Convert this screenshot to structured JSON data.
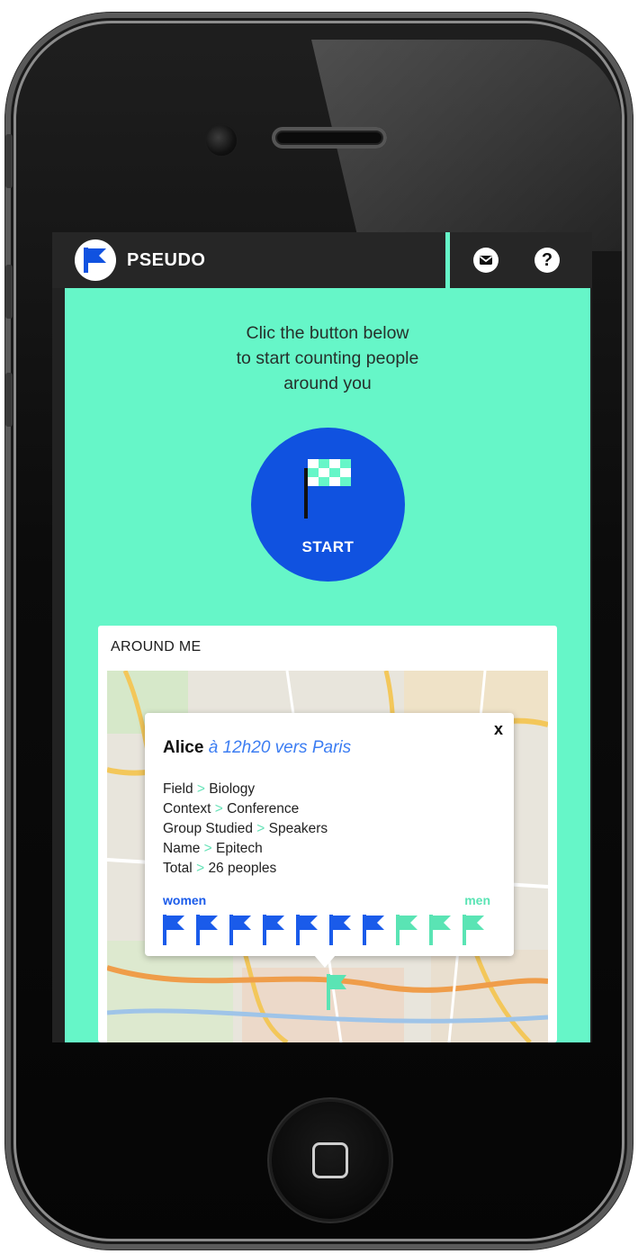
{
  "app": {
    "name": "PSEUDO"
  },
  "header": {
    "mail_icon": "envelope-icon",
    "help_label": "?"
  },
  "intro": {
    "line1": "Clic the button below",
    "line2": "to start counting people",
    "line3": "around you"
  },
  "start_button": {
    "label": "START",
    "icon": "checkered-flag-icon"
  },
  "around_me": {
    "title": "AROUND ME",
    "popup": {
      "close_label": "x",
      "name": "Alice",
      "subtitle": "à 12h20 vers Paris",
      "fields": [
        {
          "key": "Field",
          "value": "Biology"
        },
        {
          "key": "Context",
          "value": "Conference"
        },
        {
          "key": "Group Studied",
          "value": "Speakers"
        },
        {
          "key": "Name",
          "value": "Epitech"
        },
        {
          "key": "Total",
          "value": "26 peoples"
        }
      ],
      "separator": ">",
      "women_label": "women",
      "men_label": "men",
      "flags": {
        "women": 7,
        "men": 3
      }
    }
  },
  "colors": {
    "mint": "#66f6c8",
    "blue": "#1052e0",
    "flag_blue": "#1a5bea",
    "flag_mint": "#5ae4b4",
    "topbar": "#262626"
  }
}
